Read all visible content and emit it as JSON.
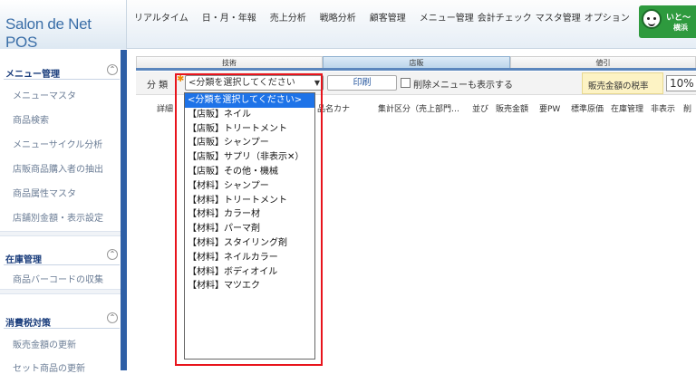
{
  "app": {
    "logo": "Salon de Net POS"
  },
  "nav": {
    "items": [
      "リアルタイム",
      "日・月・年報",
      "売上分析",
      "戦略分析",
      "顧客管理",
      "メニュー管理",
      "会計チェック",
      "マスタ管理",
      "オプション"
    ]
  },
  "user": {
    "name_line1": "いと～",
    "name_line2": "横浜"
  },
  "sidebar": {
    "sections": [
      {
        "title": "メニュー管理",
        "items": [
          "メニューマスタ",
          "商品検索",
          "メニューサイクル分析",
          "店販商品購入者の抽出",
          "商品属性マスタ",
          "店舗別金額・表示設定"
        ]
      },
      {
        "title": "在庫管理",
        "items": [
          "商品バーコードの収集"
        ]
      },
      {
        "title": "消費税対策",
        "items": [
          "販売金額の更新",
          "セット商品の更新"
        ]
      }
    ],
    "toggle_icon": "⌃"
  },
  "tabs": [
    "技術",
    "店販",
    "値引"
  ],
  "filter": {
    "category_label": "分 類",
    "required_mark": "✱",
    "select_value": "<分類を選択してください",
    "print_button": "印刷",
    "show_deleted_label": "削除メニューも表示する",
    "tax_label": "販売金額の税率",
    "tax_value": "10%"
  },
  "table_headers": [
    "詳細",
    "品名カナ",
    "集計区分（売上部門…",
    "並び",
    "販売金額",
    "要PW",
    "標準原価",
    "在庫管理",
    "非表示",
    "削"
  ],
  "dropdown": {
    "options": [
      "<分類を選択してください>",
      "【店販】ネイル",
      "【店販】トリートメント",
      "【店販】シャンプー",
      "【店販】サプリ（非表示✕）",
      "【店販】その他・機械",
      "【材料】シャンプー",
      "【材料】トリートメント",
      "【材料】カラー材",
      "【材料】パーマ剤",
      "【材料】スタイリング剤",
      "【材料】ネイルカラー",
      "【材料】ボディオイル",
      "【材料】マツエク"
    ],
    "selected_index": 0
  },
  "colors": {
    "sidebar_border": "#2e5fa6",
    "highlight": "#e8141c",
    "selected_option": "#1e73e8",
    "user_badge": "#2e9a3e"
  }
}
